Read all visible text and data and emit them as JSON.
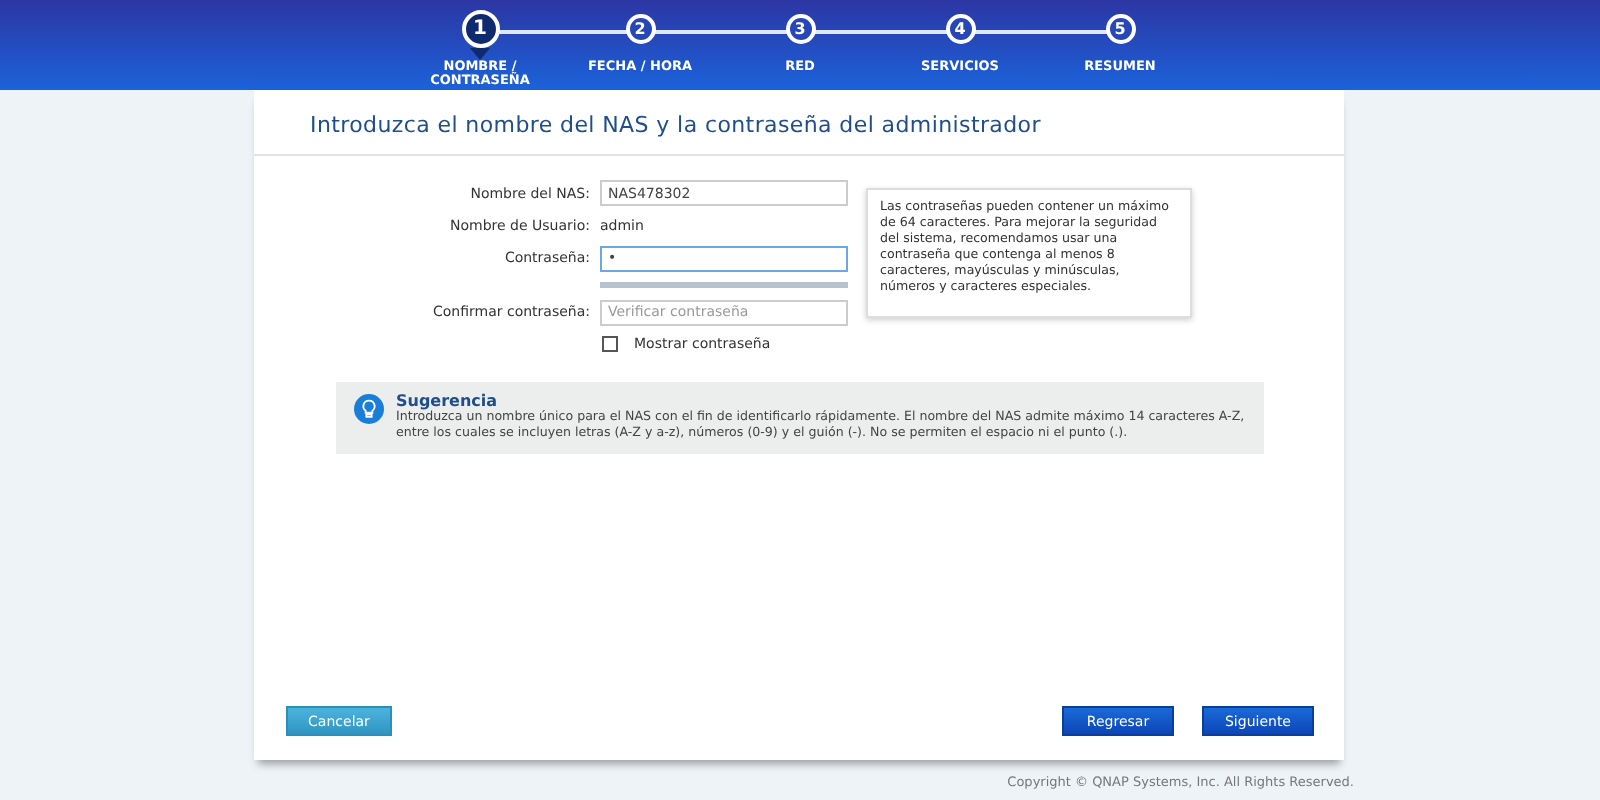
{
  "steps": [
    {
      "number": "1",
      "label": "NOMBRE / CONTRASEÑA",
      "selected": true
    },
    {
      "number": "2",
      "label": "FECHA / HORA",
      "selected": false
    },
    {
      "number": "3",
      "label": "RED",
      "selected": false
    },
    {
      "number": "4",
      "label": "SERVICIOS",
      "selected": false
    },
    {
      "number": "5",
      "label": "RESUMEN",
      "selected": false
    }
  ],
  "title": "Introduzca el nombre del NAS y la contraseña del administrador",
  "form": {
    "nas_name": {
      "label": "Nombre del NAS:",
      "value": "NAS478302"
    },
    "username": {
      "label": "Nombre de Usuario:",
      "value": "admin"
    },
    "password": {
      "label": "Contraseña:",
      "value": "•"
    },
    "confirm": {
      "label": "Confirmar contraseña:",
      "placeholder": "Verificar contraseña"
    },
    "show_password": {
      "label": "Mostrar contraseña",
      "checked": false
    }
  },
  "tooltip": "Las contraseñas pueden contener un máximo de 64 caracteres. Para mejorar la seguridad del sistema, recomendamos usar una contraseña que contenga al menos 8 caracteres, mayúsculas y minúsculas, números y caracteres especiales.",
  "hint": {
    "title": "Sugerencia",
    "text": "Introduzca un nombre único para el NAS con el fin de identificarlo rápidamente. El nombre del NAS admite máximo 14 caracteres A-Z, entre los cuales se incluyen letras (A-Z y a-z), números (0-9) y el guión (-). No se permiten el espacio ni el punto (.)."
  },
  "buttons": {
    "cancel": "Cancelar",
    "back": "Regresar",
    "next": "Siguiente"
  },
  "copyright": "Copyright © QNAP Systems, Inc. All Rights Reserved."
}
